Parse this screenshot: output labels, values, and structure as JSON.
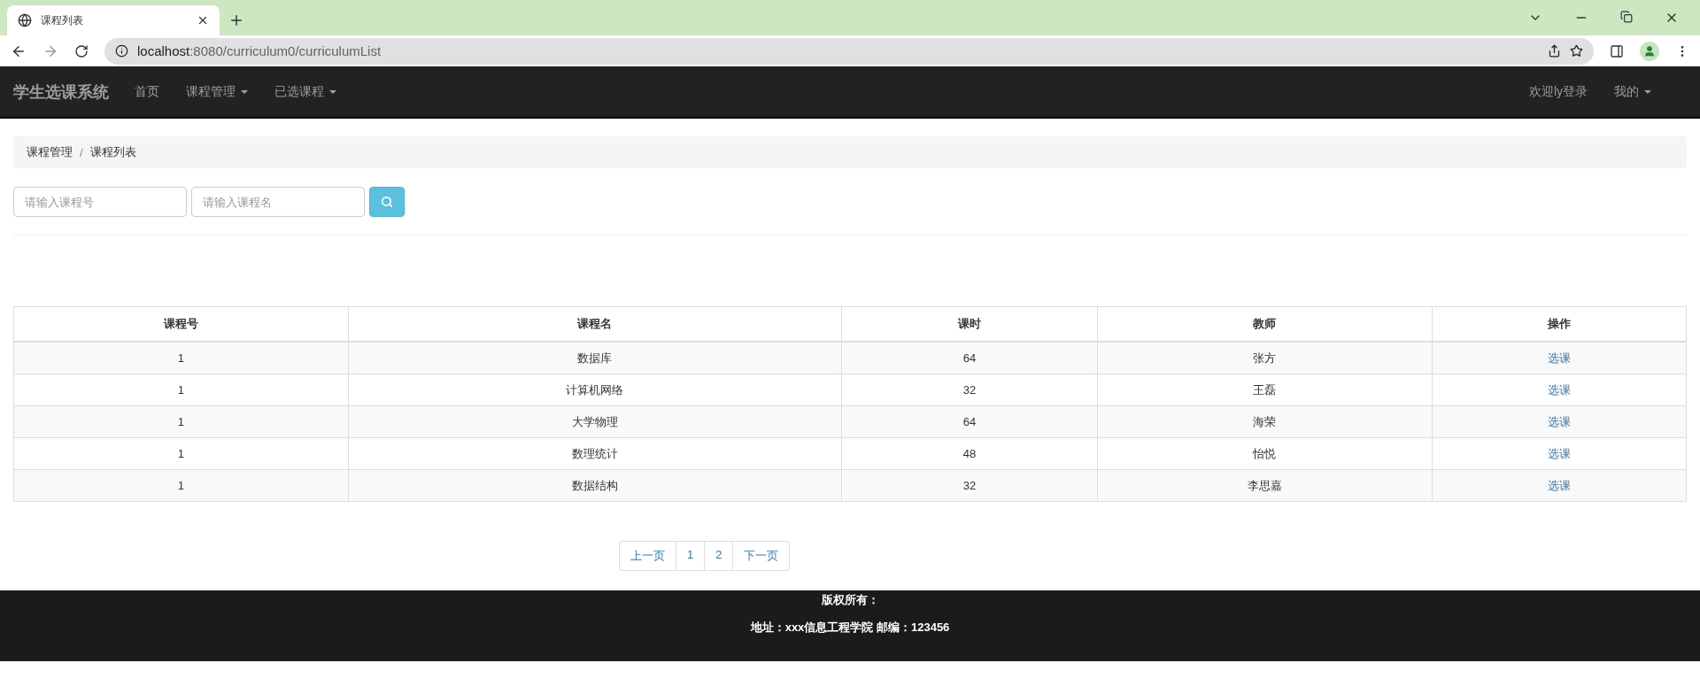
{
  "browser": {
    "tab_title": "课程列表",
    "url_host": "localhost",
    "url_rest": ":8080/curriculum0/curriculumList"
  },
  "navbar": {
    "brand": "学生选课系统",
    "items": [
      {
        "label": "首页",
        "dropdown": false
      },
      {
        "label": "课程管理",
        "dropdown": true
      },
      {
        "label": "已选课程",
        "dropdown": true
      }
    ],
    "right_items": [
      {
        "label": "欢迎ly登录",
        "dropdown": false
      },
      {
        "label": "我的",
        "dropdown": true
      }
    ]
  },
  "breadcrumb": {
    "separator": "/",
    "items": [
      "课程管理",
      "课程列表"
    ]
  },
  "search": {
    "fields": [
      {
        "placeholder": "请输入课程号"
      },
      {
        "placeholder": "请输入课程名"
      }
    ]
  },
  "table": {
    "columns": [
      "课程号",
      "课程名",
      "课时",
      "教师",
      "操作"
    ],
    "rows": [
      {
        "cells": [
          "1",
          "数据库",
          "64",
          "张方"
        ],
        "action": "选课"
      },
      {
        "cells": [
          "1",
          "计算机网络",
          "32",
          "王磊"
        ],
        "action": "选课"
      },
      {
        "cells": [
          "1",
          "大学物理",
          "64",
          "海荣"
        ],
        "action": "选课"
      },
      {
        "cells": [
          "1",
          "数理统计",
          "48",
          "怡悦"
        ],
        "action": "选课"
      },
      {
        "cells": [
          "1",
          "数据结构",
          "32",
          "李思嘉"
        ],
        "action": "选课"
      }
    ]
  },
  "pagination": [
    "上一页",
    "1",
    "2",
    "下一页"
  ],
  "footer": {
    "lines": [
      "版权所有：",
      "地址：xxx信息工程学院 邮编：123456"
    ]
  }
}
